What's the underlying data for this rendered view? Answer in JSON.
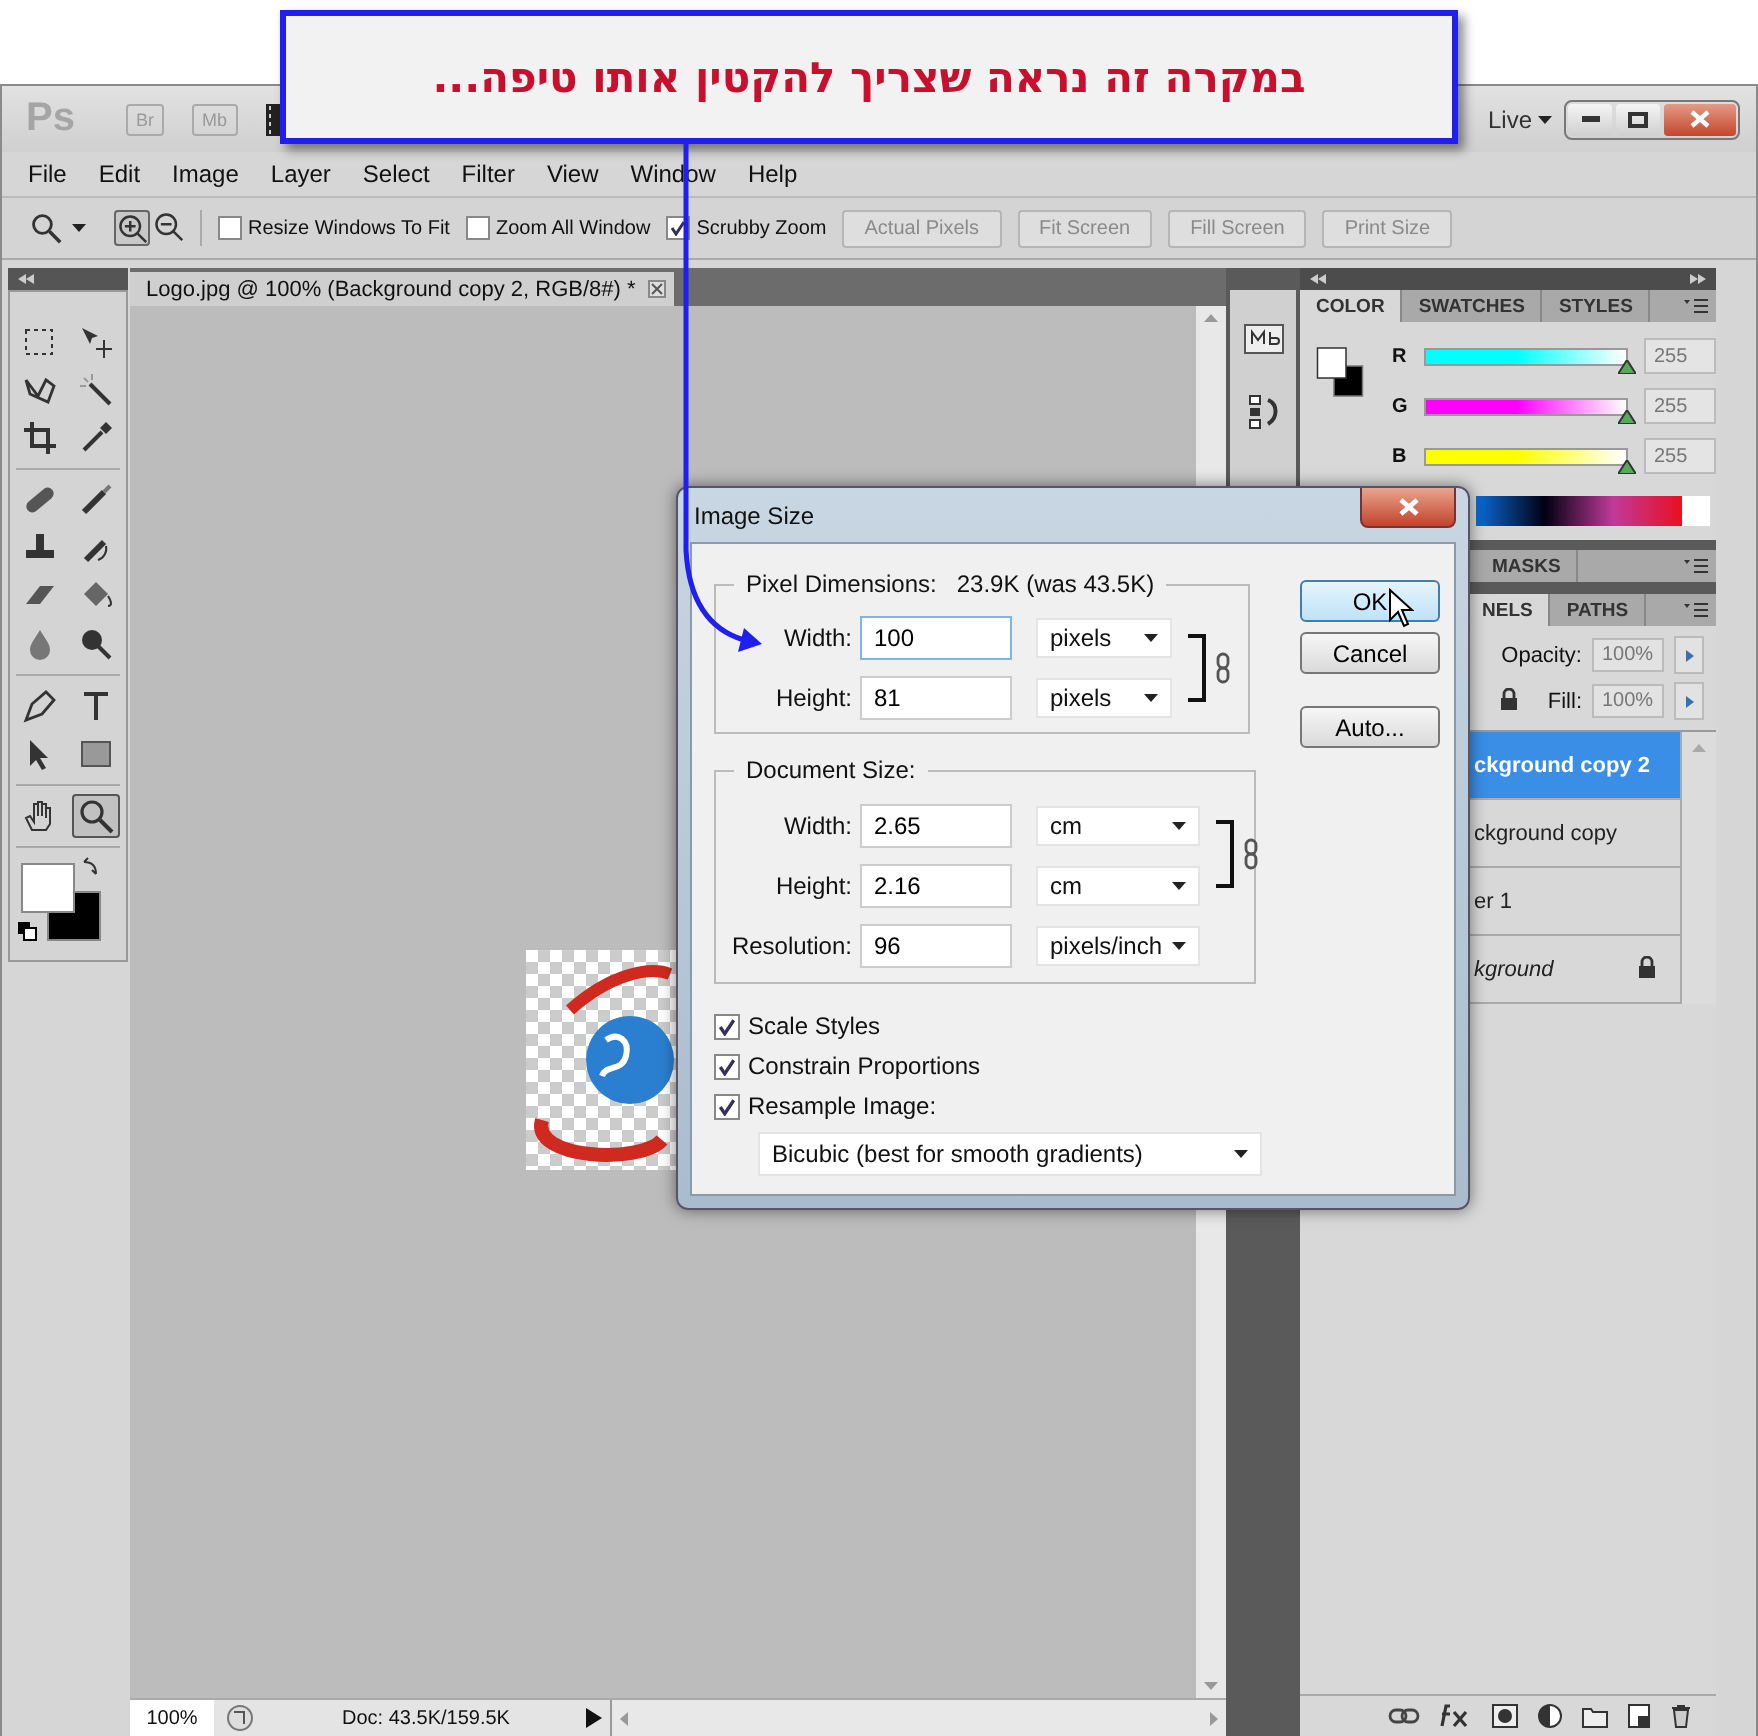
{
  "callout": {
    "text": "במקרה זה נראה שצריך להקטין אותו טיפה..."
  },
  "titlebar": {
    "logo": "Ps",
    "apps": [
      "Br",
      "Mb"
    ],
    "workspace": "Live"
  },
  "menu": [
    "File",
    "Edit",
    "Image",
    "Layer",
    "Select",
    "Filter",
    "View",
    "Window",
    "Help"
  ],
  "options_bar": {
    "checkboxes": [
      {
        "label": "Resize Windows To Fit",
        "checked": false
      },
      {
        "label": "Zoom All Window",
        "checked": false
      },
      {
        "label": "Scrubby Zoom",
        "checked": true
      }
    ],
    "buttons": [
      "Actual Pixels",
      "Fit Screen",
      "Fill Screen",
      "Print Size"
    ]
  },
  "tools": [
    {
      "kind": "marquee",
      "selected": false
    },
    {
      "kind": "move",
      "selected": false
    },
    {
      "kind": "lasso",
      "selected": false
    },
    {
      "kind": "wand",
      "selected": false
    },
    {
      "kind": "crop",
      "selected": false
    },
    {
      "kind": "eyedropper",
      "selected": false
    },
    {
      "kind": "bandage",
      "selected": false
    },
    {
      "kind": "brush",
      "selected": false
    },
    {
      "kind": "stamp",
      "selected": false
    },
    {
      "kind": "history",
      "selected": false
    },
    {
      "kind": "eraser",
      "selected": false
    },
    {
      "kind": "bucket",
      "selected": false
    },
    {
      "kind": "drop",
      "selected": false
    },
    {
      "kind": "dodge",
      "selected": false
    },
    {
      "kind": "pen",
      "selected": false
    },
    {
      "kind": "type",
      "selected": false
    },
    {
      "kind": "arrow",
      "selected": false
    },
    {
      "kind": "rectangle",
      "selected": false
    },
    {
      "kind": "hand",
      "selected": false
    },
    {
      "kind": "magnifier",
      "selected": true
    }
  ],
  "document": {
    "tab": "Logo.jpg @ 100% (Background copy 2, RGB/8#) *",
    "zoom": "100%",
    "doc_info": "Doc: 43.5K/159.5K"
  },
  "color_panel": {
    "tabs": [
      {
        "label": "COLOR",
        "selected": true
      },
      {
        "label": "SWATCHES",
        "selected": false
      },
      {
        "label": "STYLES",
        "selected": false
      }
    ],
    "channels": [
      {
        "name": "R",
        "value": "255",
        "level": 1,
        "color": "#00ffff"
      },
      {
        "name": "G",
        "value": "255",
        "level": 1,
        "color": "#ff00ff"
      },
      {
        "name": "B",
        "value": "255",
        "level": 1,
        "color": "#ffff00"
      }
    ]
  },
  "masks_panel": {
    "tabs": [
      {
        "label": "MASKS",
        "selected": false
      }
    ]
  },
  "layers_panel": {
    "tabs": [
      {
        "label": "NELS",
        "selected": true
      },
      {
        "label": "PATHS",
        "selected": false
      }
    ],
    "opacity_label": "Opacity:",
    "opacity": "100%",
    "fill_label": "Fill:",
    "fill": "100%",
    "layers": [
      {
        "name": "ckground copy 2",
        "selected": true,
        "italic": false,
        "locked": false
      },
      {
        "name": "ckground copy",
        "selected": false,
        "italic": false,
        "locked": false
      },
      {
        "name": "er 1",
        "selected": false,
        "italic": false,
        "locked": false
      },
      {
        "name": "kground",
        "selected": false,
        "italic": true,
        "locked": true
      }
    ]
  },
  "dialog": {
    "title": "Image Size",
    "pixel_dimensions": {
      "label": "Pixel Dimensions:",
      "value": "23.9K (was 43.5K)",
      "fields": [
        {
          "label": "Width:",
          "value": "100",
          "unit": "pixels",
          "focused": true
        },
        {
          "label": "Height:",
          "value": "81",
          "unit": "pixels",
          "focused": false
        }
      ]
    },
    "document_size": {
      "label": "Document Size:",
      "fields": [
        {
          "label": "Width:",
          "value": "2.65",
          "unit": "cm",
          "focused": false
        },
        {
          "label": "Height:",
          "value": "2.16",
          "unit": "cm",
          "focused": false
        },
        {
          "label": "Resolution:",
          "value": "96",
          "unit": "pixels/inch",
          "focused": false
        }
      ]
    },
    "options": [
      {
        "label": "Scale Styles",
        "checked": true
      },
      {
        "label": "Constrain Proportions",
        "checked": true
      },
      {
        "label": "Resample Image:",
        "checked": true
      }
    ],
    "resample": "Bicubic (best for smooth gradients)",
    "buttons": [
      {
        "label": "OK",
        "default": true
      },
      {
        "label": "Cancel",
        "default": false
      },
      {
        "label": "Auto...",
        "default": false
      }
    ]
  }
}
